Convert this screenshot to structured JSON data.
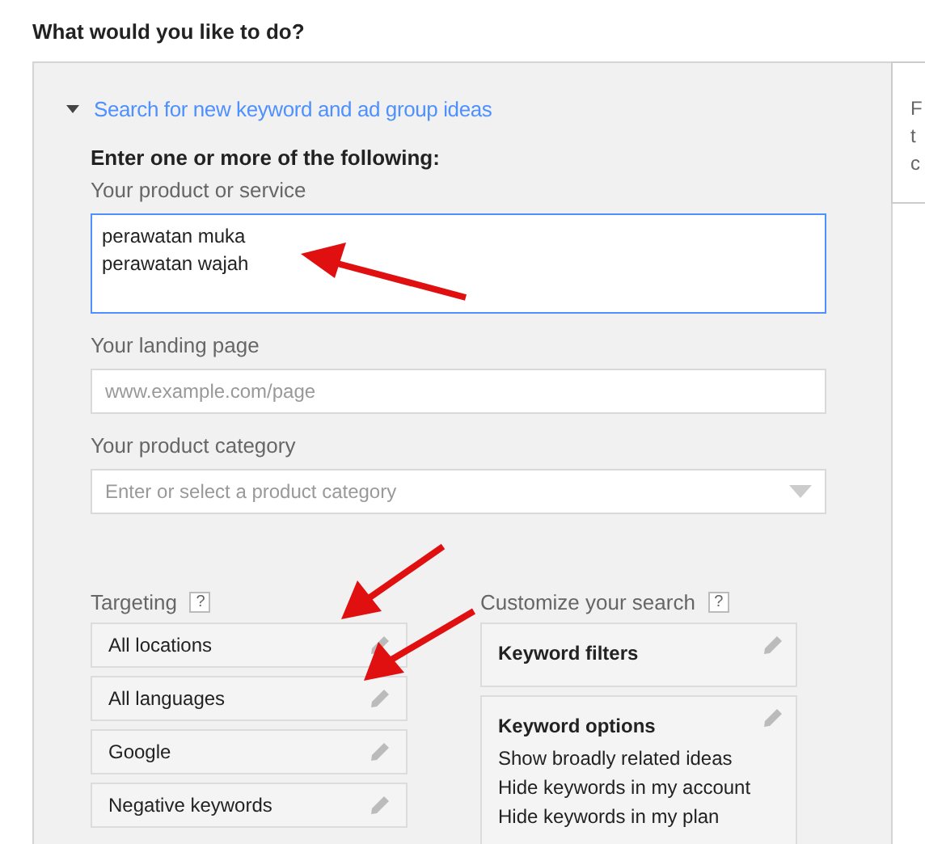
{
  "heading": "What would you like to do?",
  "section": {
    "title": "Search for new keyword and ad group ideas",
    "expanded": true,
    "intro": "Enter one or more of the following:",
    "product": {
      "label": "Your product or service",
      "lines": [
        "perawatan muka",
        "perawatan wajah"
      ]
    },
    "landing": {
      "label": "Your landing page",
      "placeholder": "www.example.com/page"
    },
    "category": {
      "label": "Your product category",
      "placeholder": "Enter or select a product category"
    },
    "targeting": {
      "label": "Targeting",
      "help": "?",
      "items": [
        "All locations",
        "All languages",
        "Google",
        "Negative keywords"
      ]
    },
    "customize": {
      "label": "Customize your search",
      "help": "?",
      "boxes": [
        {
          "title": "Keyword filters"
        },
        {
          "title": "Keyword options",
          "lines": [
            "Show broadly related ideas",
            "Hide keywords in my account",
            "Hide keywords in my plan"
          ]
        }
      ]
    }
  },
  "side_panel": {
    "lines": [
      "F",
      "t",
      "c"
    ]
  }
}
